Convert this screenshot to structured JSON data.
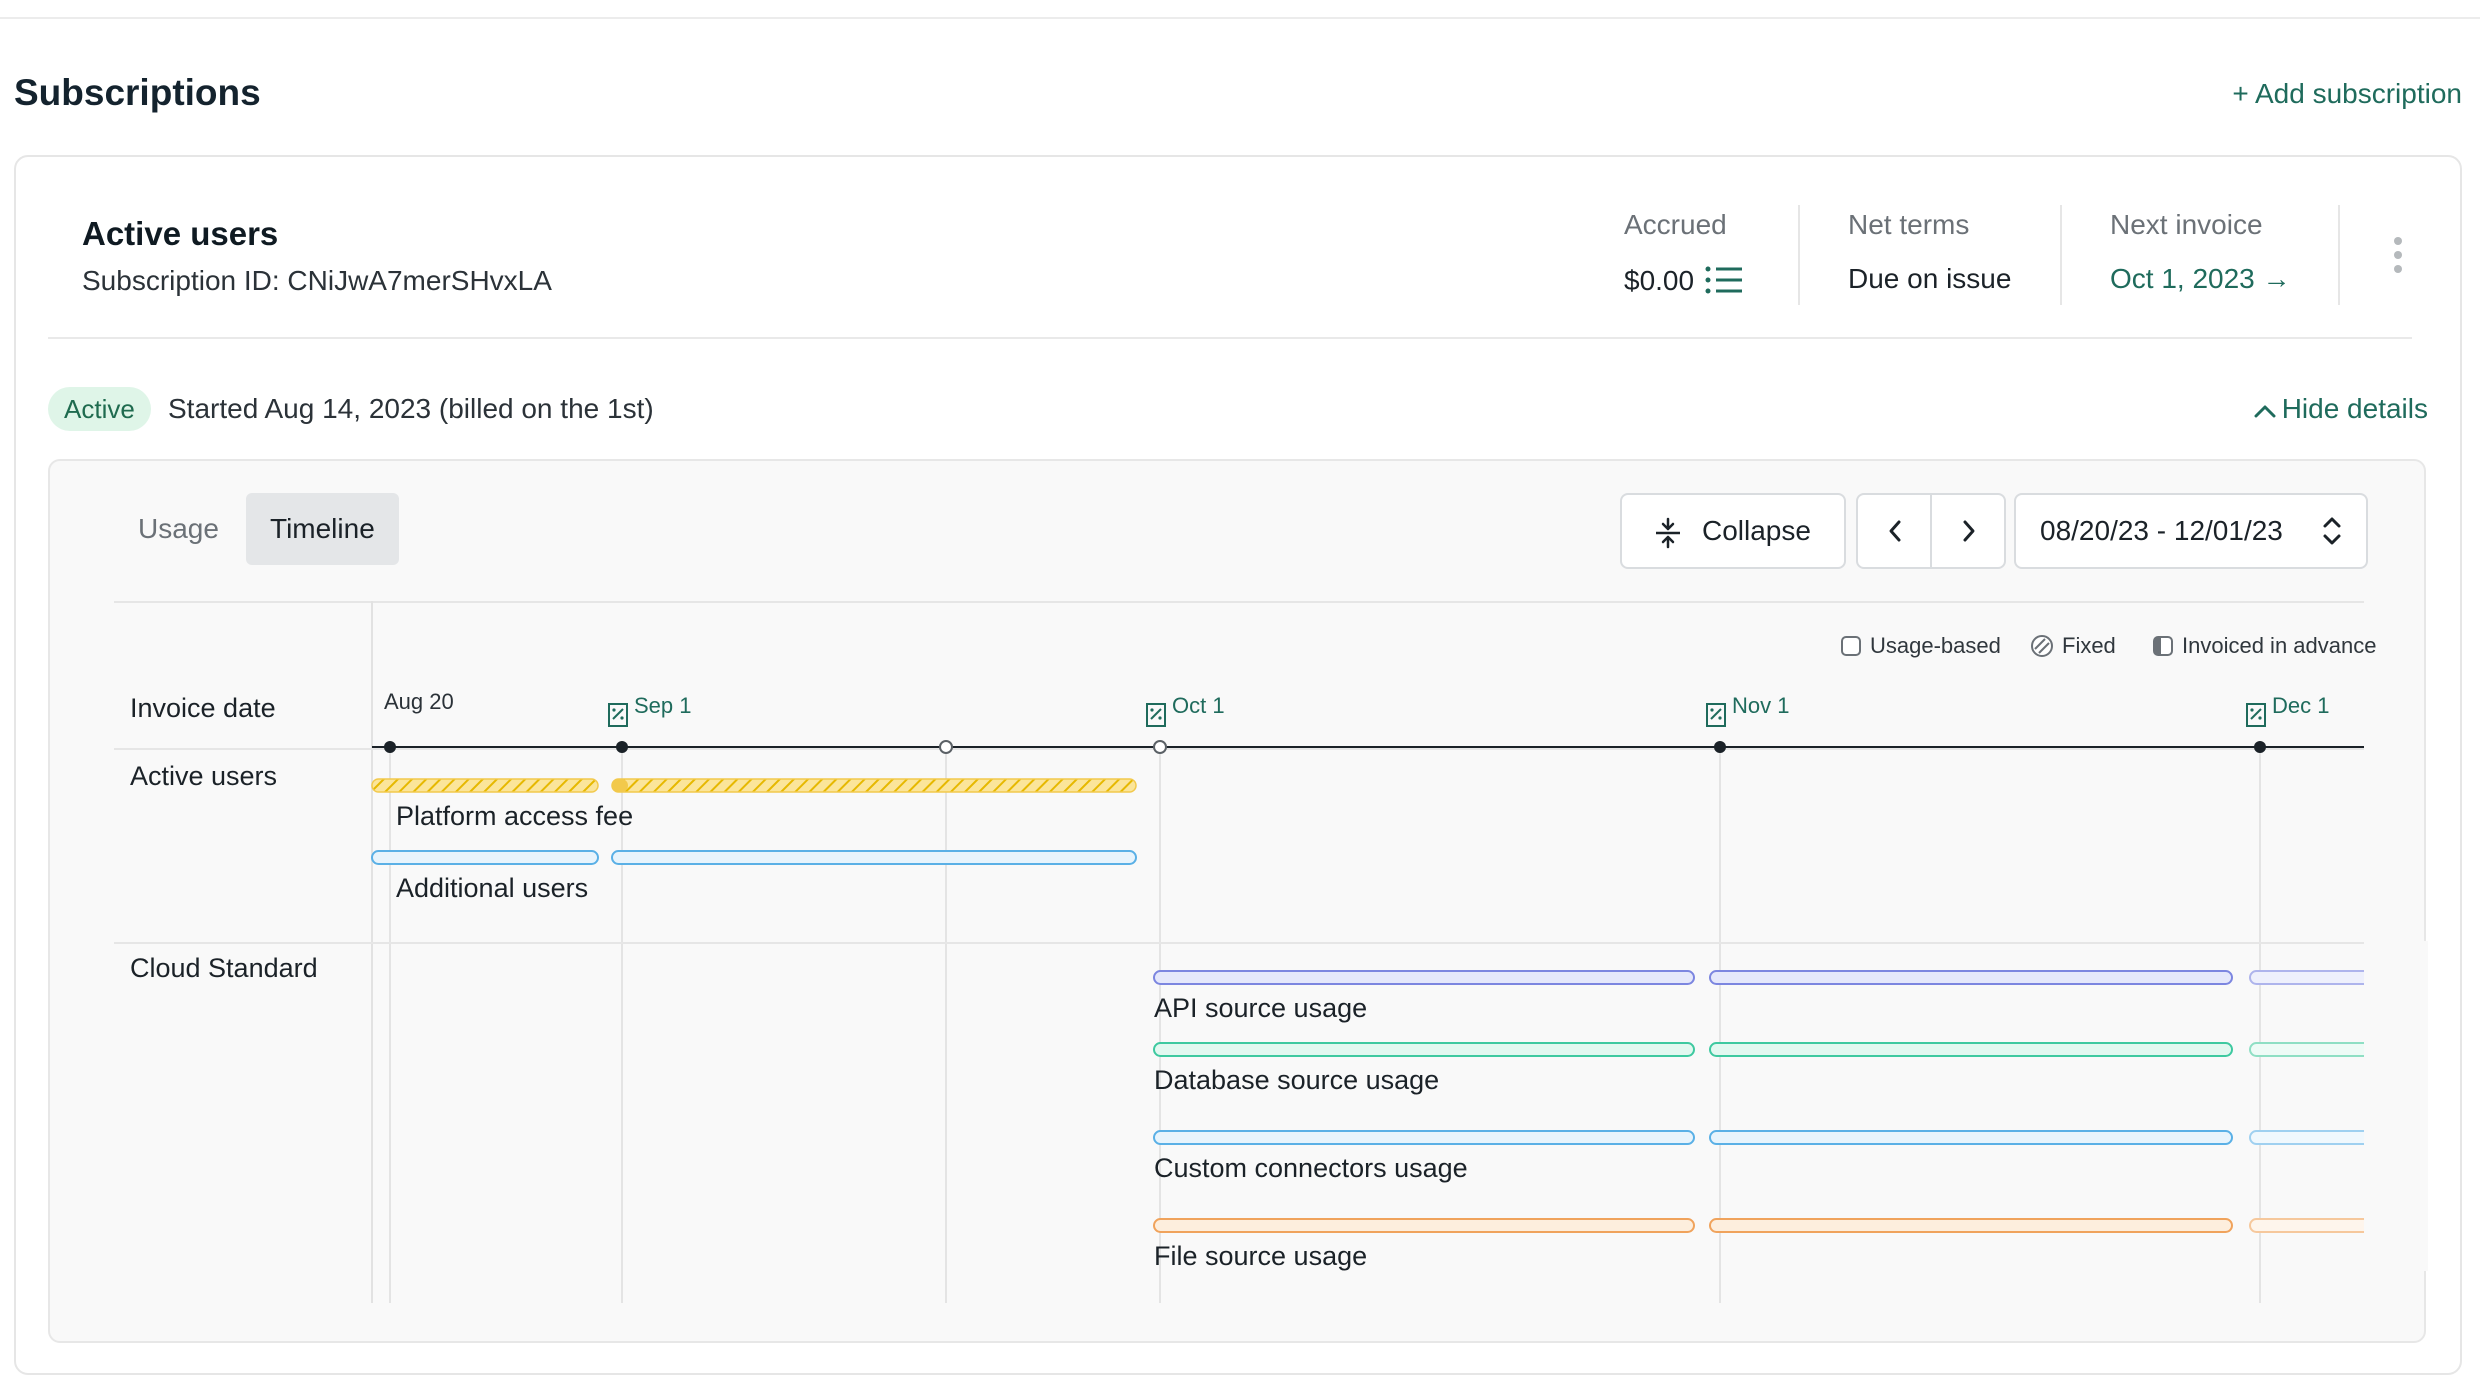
{
  "header": {
    "title": "Subscriptions",
    "add_label": "+ Add subscription"
  },
  "subscription": {
    "name": "Active users",
    "id_text": "Subscription ID: CNiJwA7merSHvxLA",
    "accrued_label": "Accrued",
    "accrued_value": "$0.00",
    "net_terms_label": "Net terms",
    "net_terms_value": "Due on issue",
    "next_invoice_label": "Next invoice",
    "next_invoice_value": "Oct 1, 2023 →",
    "status": "Active",
    "started_text": "Started Aug 14, 2023 (billed on the 1st)",
    "hide_details_label": "Hide details"
  },
  "panel": {
    "tabs": [
      {
        "label": "Usage",
        "selected": false
      },
      {
        "label": "Timeline",
        "selected": true
      }
    ],
    "collapse_label": "Collapse",
    "date_range": "08/20/23 - 12/01/23",
    "legend": {
      "usage_based": "Usage-based",
      "fixed": "Fixed",
      "invoiced_in_advance": "Invoiced in advance"
    }
  },
  "timeline": {
    "invoice_date_label": "Invoice date",
    "dates": [
      "Aug 20",
      "Sep 1",
      "Oct 1",
      "Nov 1",
      "Dec 1"
    ],
    "groups": [
      {
        "name": "Active users",
        "items": [
          {
            "label": "Platform access fee",
            "kind": "fixed",
            "color": "#f2c94c"
          },
          {
            "label": "Additional users",
            "kind": "usage",
            "color": "#5ab0e6"
          }
        ]
      },
      {
        "name": "Cloud Standard",
        "items": [
          {
            "label": "API source usage",
            "kind": "usage",
            "color": "#7c86e0"
          },
          {
            "label": "Database source usage",
            "kind": "usage",
            "color": "#3ec9a0"
          },
          {
            "label": "Custom connectors usage",
            "kind": "usage",
            "color": "#5ab0e6"
          },
          {
            "label": "File source usage",
            "kind": "usage",
            "color": "#f0a35c"
          }
        ]
      }
    ]
  },
  "colors": {
    "accent": "#1f6b5c",
    "badge_bg": "#dff5e8",
    "panel_bg": "#f9f9f9"
  }
}
